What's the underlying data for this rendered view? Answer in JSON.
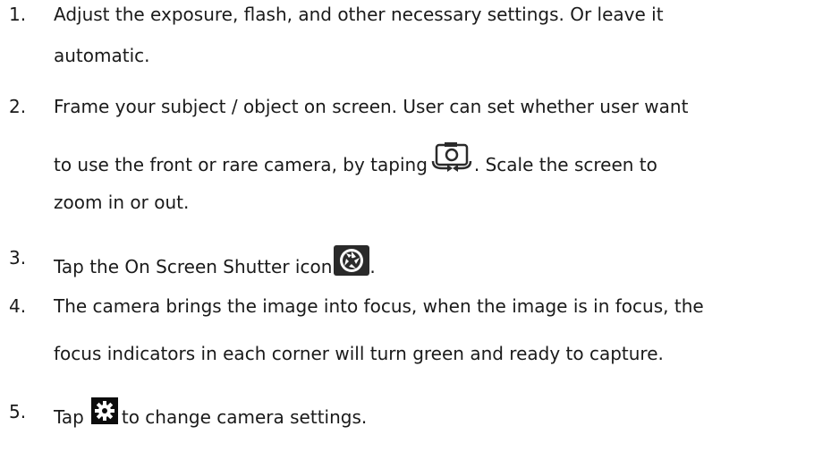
{
  "steps": [
    {
      "number": "1.",
      "lines": [
        "Adjust the exposure, flash, and other necessary settings. Or leave it",
        "automatic."
      ]
    },
    {
      "number": "2.",
      "lines": [
        "Frame your subject / object on screen. User can set whether user want",
        "to use the front or rare camera, by taping",
        ". Scale the screen to",
        "zoom in or out."
      ]
    },
    {
      "number": "3.",
      "text_before_icon": "Tap the On Screen Shutter icon",
      "text_after_icon": "."
    },
    {
      "number": "4.",
      "lines": [
        "The camera brings the image into focus, when the image is in focus, the",
        "focus indicators in each corner will turn green and ready to capture."
      ]
    },
    {
      "number": "5.",
      "text_before_icon": "Tap",
      "text_after_icon": "to change camera settings."
    }
  ],
  "icons": {
    "camera_switch": "camera-switch-icon",
    "shutter": "shutter-icon",
    "settings": "gear-icon"
  }
}
